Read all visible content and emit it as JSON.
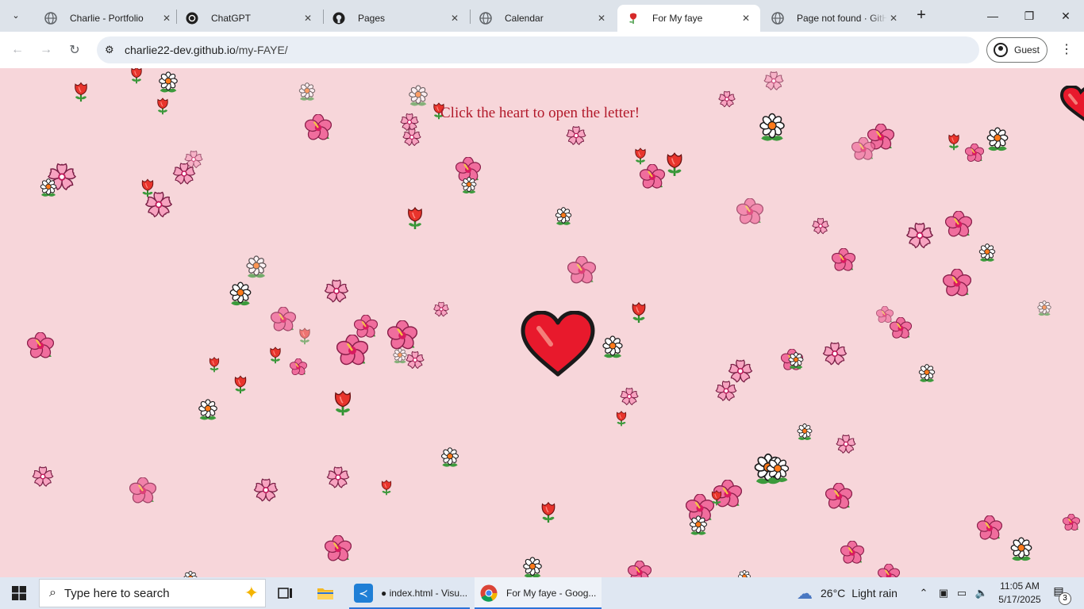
{
  "browser": {
    "tabs": [
      {
        "title": "Charlie - Portfolio",
        "favicon": "globe-icon",
        "active": false
      },
      {
        "title": "ChatGPT",
        "favicon": "chatgpt-icon",
        "active": false
      },
      {
        "title": "Pages",
        "favicon": "github-icon",
        "active": false
      },
      {
        "title": "Calendar",
        "favicon": "globe-icon",
        "active": false
      },
      {
        "title": "For My faye",
        "favicon": "rose-icon",
        "active": true
      },
      {
        "title": "Page not found · GitHub",
        "favicon": "globe-icon",
        "active": false
      }
    ],
    "url_host": "charlie22-dev.github.io",
    "url_path": "/my-FAYE/",
    "profile_label": "Guest"
  },
  "page": {
    "heading": "Click the heart to open the letter!",
    "background_color": "#f7d6da",
    "heading_color": "#b2192a",
    "heart_color": "#e8192c"
  },
  "taskbar": {
    "search_placeholder": "Type here to search",
    "apps": [
      {
        "label": "● index.html - Visu...",
        "icon": "vscode-icon"
      },
      {
        "label": "For My faye - Goog...",
        "icon": "chrome-icon",
        "active": true
      }
    ],
    "weather": {
      "temp": "26°C",
      "condition": "Light rain"
    },
    "time": "11:05 AM",
    "date": "5/17/2025",
    "notification_count": "3"
  }
}
